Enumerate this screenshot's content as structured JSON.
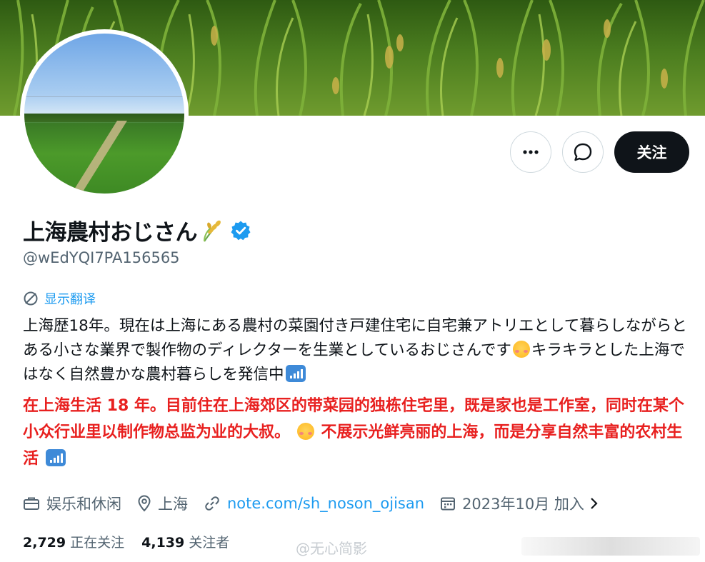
{
  "profile": {
    "display_name": "上海農村おじさん",
    "handle": "@wEdYQI7PA156565",
    "follow_label": "关注"
  },
  "translate": {
    "label": "显示翻译"
  },
  "bio": {
    "jp_part1": "上海歴18年。現在は上海にある農村の菜園付き戸建住宅に自宅兼アトリエとして暮らしながらとある小さな業界で製作物のディレクターを生業としているおじさんです",
    "jp_part2": "キラキラとした上海ではなく自然豊かな農村暮らしを発信中",
    "zh_part1": "在上海生活 18 年。目前住在上海郊区的带菜园的独栋住宅里，既是家也是工作室，同时在某个小众行业里以制作物总监为业的大叔。",
    "zh_part2": "不展示光鲜亮丽的上海，而是分享自然丰富的农村生活"
  },
  "meta": {
    "category": "娱乐和休闲",
    "location": "上海",
    "link": "note.com/sh_noson_ojisan",
    "joined": "2023年10月 加入"
  },
  "stats": {
    "following_count": "2,729",
    "following_label": "正在关注",
    "followers_count": "4,139",
    "followers_label": "关注者"
  },
  "watermark": "@无心简影",
  "icons": {
    "more": "more-dots-icon",
    "message": "message-bubble-icon",
    "verified": "verified-badge-icon",
    "translate": "translate-icon",
    "category": "briefcase-icon",
    "location": "location-pin-icon",
    "link": "link-icon",
    "joined": "calendar-icon"
  },
  "colors": {
    "accent": "#1d9bf0",
    "text_primary": "#0f1419",
    "text_secondary": "#536471",
    "translation_red": "#e8201f",
    "follow_bg": "#0f1419"
  }
}
